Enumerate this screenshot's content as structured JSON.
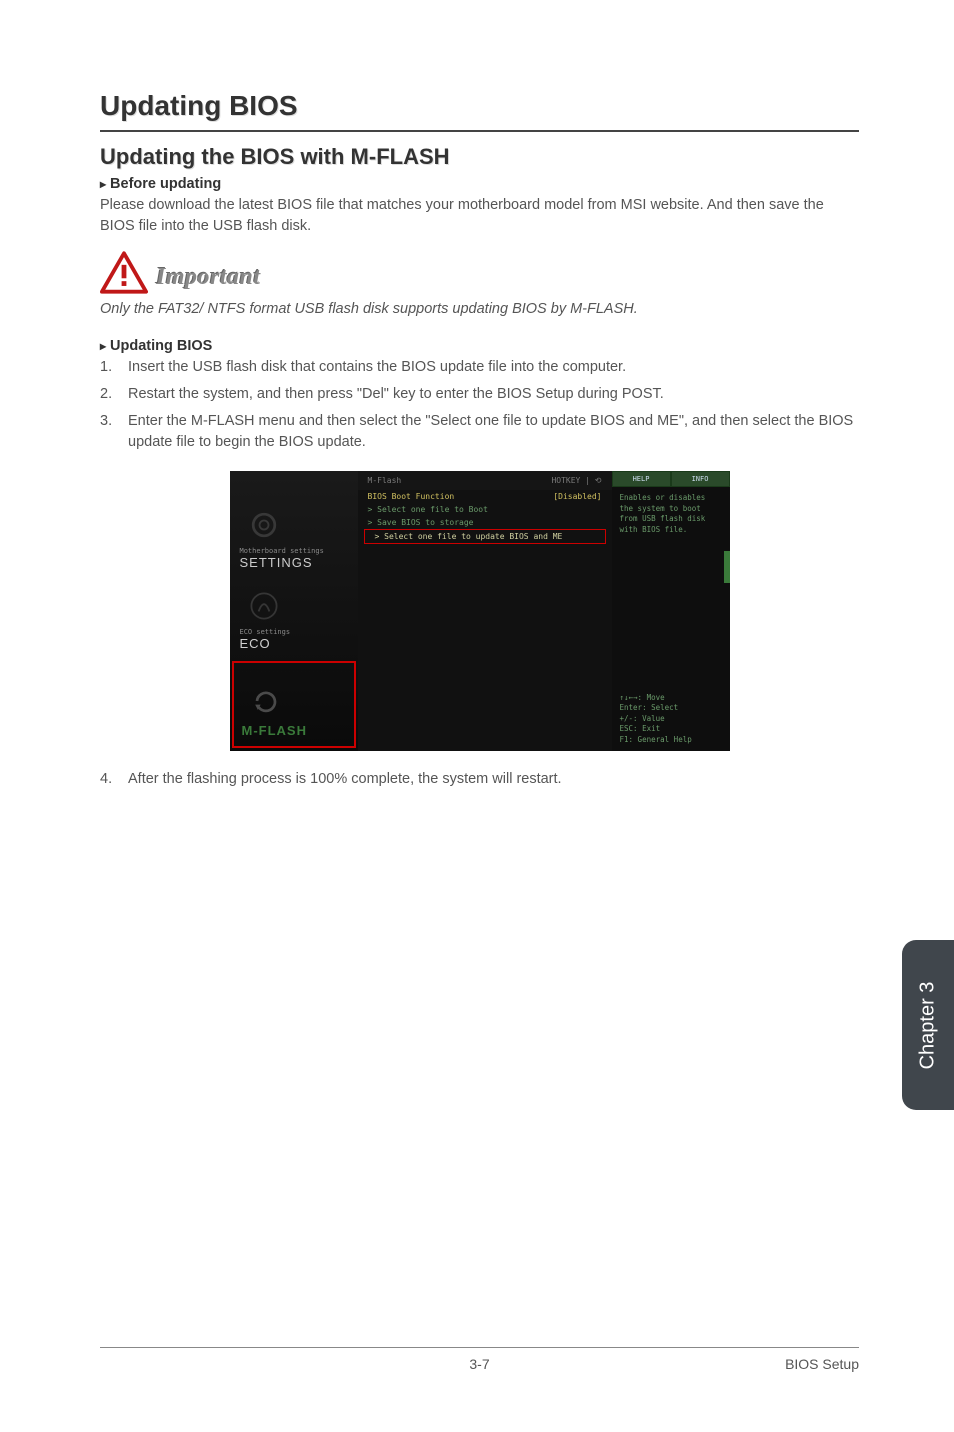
{
  "heading": "Updating BIOS",
  "section_title": "Updating the BIOS with M-FLASH",
  "before_head": "Before updating",
  "before_text": "Please download the latest BIOS file that matches your motherboard model from MSI website. And then save the BIOS file into the USB flash disk.",
  "important_label": "Important",
  "important_note": "Only the FAT32/ NTFS format USB flash disk supports updating BIOS by M-FLASH.",
  "updating_head": "Updating BIOS",
  "steps": [
    "Insert the USB flash disk that contains the BIOS update file into the computer.",
    "Restart the system, and then press \"Del\" key to enter the BIOS Setup during POST.",
    "Enter the M-FLASH menu and then select the \"Select one file to update BIOS and ME\", and then select the BIOS update file to begin the BIOS update."
  ],
  "step4": "After the flashing process is 100% complete, the system will restart.",
  "screenshot": {
    "left": {
      "settings_sub": "Motherboard settings",
      "settings": "SETTINGS",
      "eco_sub": "ECO settings",
      "eco": "ECO",
      "mflash": "M-FLASH"
    },
    "top": {
      "title": "M-Flash",
      "hotkey": "HOTKEY | ⟲"
    },
    "lines": {
      "l1a": "BIOS Boot Function",
      "l1b": "[Disabled]",
      "l2": "> Select one file to Boot",
      "l3": "> Save BIOS to storage",
      "sel": "> Select one file to update BIOS and ME"
    },
    "right": {
      "tab1": "HELP",
      "tab2": "INFO",
      "help": "Enables or disables the system to boot from USB flash disk with BIOS file.",
      "keys": "↑↓←→: Move\nEnter: Select\n+/-: Value\nESC: Exit\nF1: General Help"
    }
  },
  "chapter_tab": "Chapter 3",
  "footer": {
    "page": "3-7",
    "section": "BIOS Setup"
  }
}
